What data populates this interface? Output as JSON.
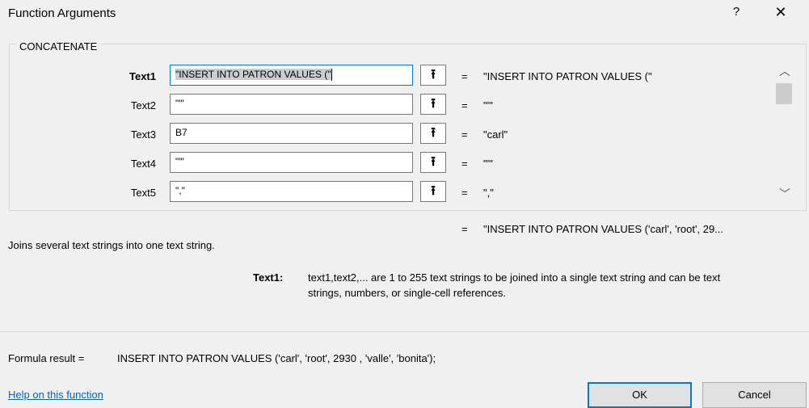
{
  "dialog": {
    "title": "Function Arguments",
    "help_glyph": "?",
    "close_glyph": "✕"
  },
  "function_name": "CONCATENATE",
  "arguments": [
    {
      "label": "Text1",
      "input": "\"INSERT INTO PATRON VALUES (\"",
      "value": "\"INSERT INTO PATRON VALUES (\"",
      "active": true
    },
    {
      "label": "Text2",
      "input": "\"'\"",
      "value": "\"'\"",
      "active": false
    },
    {
      "label": "Text3",
      "input": "B7",
      "value": "\"carl\"",
      "active": false
    },
    {
      "label": "Text4",
      "input": "\"'\"",
      "value": "\"'\"",
      "active": false
    },
    {
      "label": "Text5",
      "input": "\",\"",
      "value": "\",\"",
      "active": false
    }
  ],
  "equals_sign": "=",
  "collapse_glyph": "⭱",
  "scroll": {
    "up_glyph": "︿",
    "down_glyph": "﹀"
  },
  "overall_result_preview": "\"INSERT INTO PATRON VALUES ('carl', 'root', 29...",
  "function_description": "Joins several text strings into one text string.",
  "argument_help": {
    "name": "Text1:",
    "line1": "text1,text2,... are 1 to 255 text strings to be joined into a single text string and can be text",
    "line2": "strings, numbers, or single-cell references."
  },
  "formula_result": {
    "label": "Formula result =",
    "value": "INSERT INTO PATRON VALUES ('carl', 'root', 2930 , 'valle', 'bonita');"
  },
  "footer": {
    "help_link": "Help on this function",
    "ok_label": "OK",
    "cancel_label": "Cancel"
  },
  "colors": {
    "accent": "#0078d7",
    "link": "#0563c1",
    "background": "#f0f0f0"
  }
}
